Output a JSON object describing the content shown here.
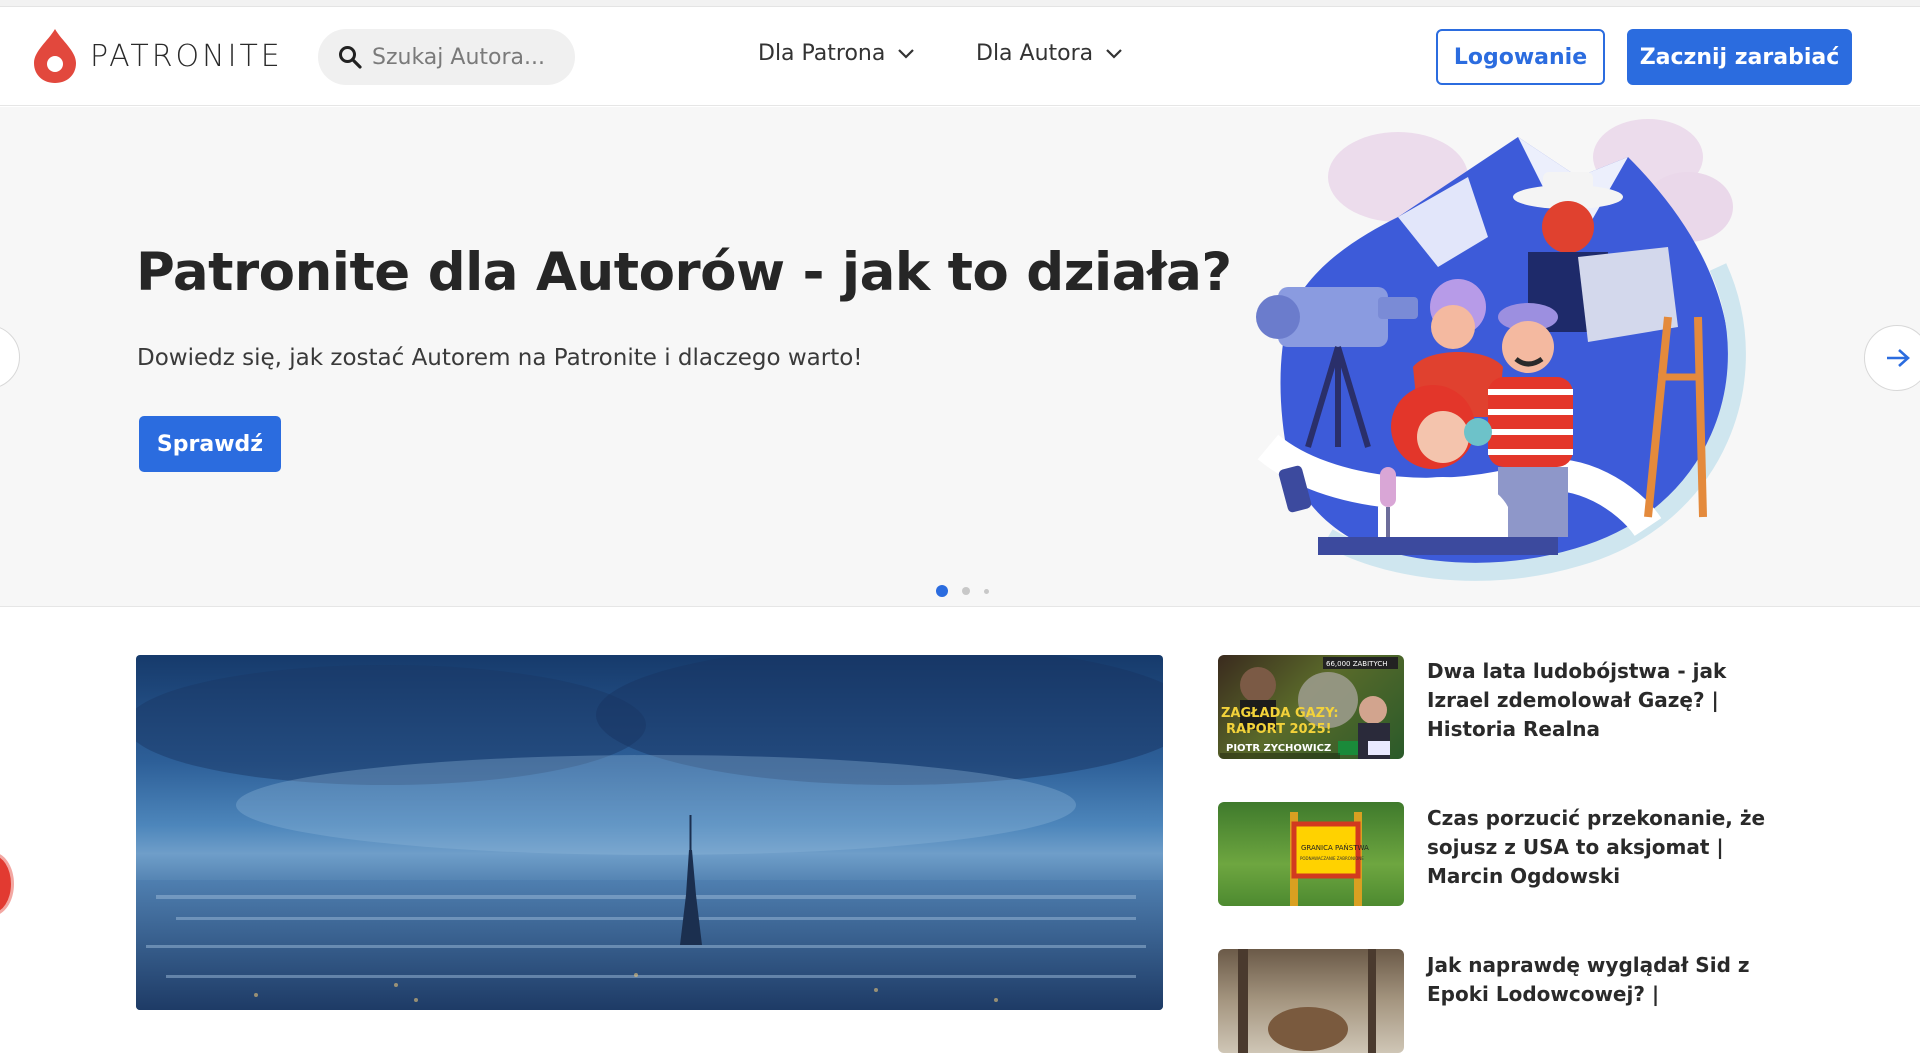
{
  "header": {
    "logo_text": "PATRONITE",
    "search_placeholder": "Szukaj Autora...",
    "nav": [
      {
        "label": "Dla Patrona"
      },
      {
        "label": "Dla Autora"
      }
    ],
    "login_label": "Logowanie",
    "start_label": "Zacznij zarabiać"
  },
  "hero": {
    "title": "Patronite dla Autorów - jak to działa?",
    "subtitle": "Dowiedz się, jak zostać Autorem na Patronite i dlaczego warto!",
    "cta_label": "Sprawdź",
    "slides_total": 3,
    "active_slide": 1
  },
  "thumb_texts": {
    "zaglada_line1": "ZAGŁADA GAZY:",
    "zaglada_line2": "RAPORT 2025!",
    "zaglada_author": "PIOTR ZYCHOWICZ",
    "zaglada_badge": "66,000 ZABITYCH",
    "granica_line1": "GRANICA PAŃSTWA",
    "granica_line2": "PODNAWACZANIE ZABRONIONE"
  },
  "news": [
    {
      "title": "Dwa lata ludobójstwa - jak Izrael zdemolował Gazę? | Historia Realna"
    },
    {
      "title": "Czas porzucić przekonanie, że sojusz z USA to aksjomat | Marcin Ogdowski"
    },
    {
      "title": "Jak naprawdę wyglądał Sid z Epoki Lodowcowej? |"
    }
  ],
  "colors": {
    "brand_blue": "#2b6cdf",
    "logo_red": "#e2483d",
    "hero_bg": "#f7f7f7"
  }
}
